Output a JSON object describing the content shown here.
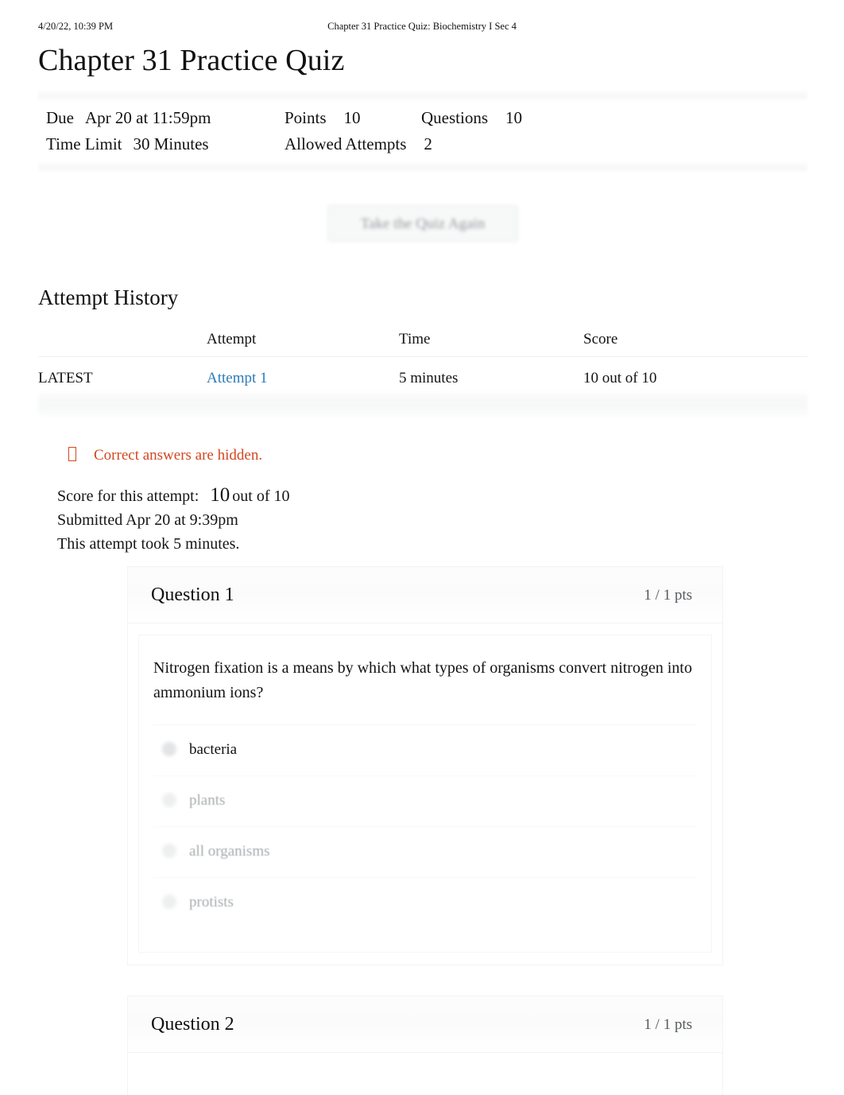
{
  "print_header": {
    "timestamp": "4/20/22, 10:39 PM",
    "document_title": "Chapter 31 Practice Quiz: Biochemistry I Sec 4"
  },
  "page_title": "Chapter 31 Practice Quiz",
  "quiz_info": {
    "due_label": "Due",
    "due_value": "Apr 20 at 11:59pm",
    "points_label": "Points",
    "points_value": "10",
    "questions_label": "Questions",
    "questions_value": "10",
    "time_limit_label": "Time Limit",
    "time_limit_value": "30 Minutes",
    "allowed_attempts_label": "Allowed Attempts",
    "allowed_attempts_value": "2"
  },
  "retake_button": {
    "label": "Take the Quiz Again"
  },
  "attempt_history": {
    "title": "Attempt History",
    "columns": [
      "",
      "Attempt",
      "Time",
      "Score"
    ],
    "rows": [
      {
        "flag": "LATEST",
        "attempt": "Attempt 1",
        "time": "5 minutes",
        "score": "10 out of 10"
      }
    ]
  },
  "notice": {
    "icon": "warning-icon",
    "text": "Correct answers are hidden."
  },
  "attempt_summary": {
    "score_label": "Score for this attempt:",
    "score_value": "10",
    "score_suffix": "out of 10",
    "submitted": "Submitted Apr 20 at 9:39pm",
    "duration": "This attempt took 5 minutes."
  },
  "questions": [
    {
      "title": "Question 1",
      "points": "1 / 1 pts",
      "text": "Nitrogen fixation is a means by which what types of organisms convert nitrogen into ammonium ions?",
      "answers": [
        {
          "label": "bacteria",
          "selected": true
        },
        {
          "label": "plants",
          "selected": false
        },
        {
          "label": "all organisms",
          "selected": false
        },
        {
          "label": "protists",
          "selected": false
        }
      ]
    },
    {
      "title": "Question 2",
      "points": "1 / 1 pts",
      "text": "",
      "answers": []
    }
  ],
  "colors": {
    "link_blue": "#2b7bb9",
    "notice_orange": "#d1481f",
    "text_primary": "#131313",
    "text_muted": "#a6abae",
    "points_gray": "#555b5e"
  }
}
